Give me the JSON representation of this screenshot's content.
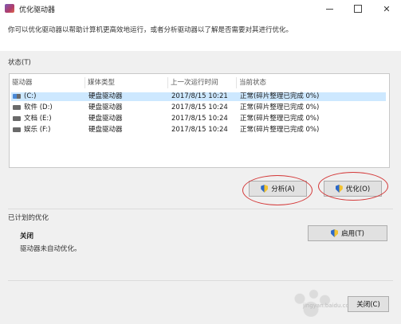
{
  "window": {
    "title": "优化驱动器",
    "controls": [
      "minimize-icon",
      "maximize-icon",
      "close-icon"
    ]
  },
  "intro": "你可以优化驱动器以帮助计算机更高效地运行，或者分析驱动器以了解是否需要对其进行优化。",
  "status": {
    "label": "状态(T)",
    "columns": [
      "驱动器",
      "媒体类型",
      "上一次运行时间",
      "当前状态"
    ],
    "drives": [
      {
        "name": "(C:)",
        "media": "硬盘驱动器",
        "last_run": "2017/8/15 10:21",
        "state": "正常(碎片整理已完成 0%)",
        "selected": true
      },
      {
        "name": "软件 (D:)",
        "media": "硬盘驱动器",
        "last_run": "2017/8/15 10:24",
        "state": "正常(碎片整理已完成 0%)",
        "selected": false
      },
      {
        "name": "文档 (E:)",
        "media": "硬盘驱动器",
        "last_run": "2017/8/15 10:24",
        "state": "正常(碎片整理已完成 0%)",
        "selected": false
      },
      {
        "name": "娱乐 (F:)",
        "media": "硬盘驱动器",
        "last_run": "2017/8/15 10:24",
        "state": "正常(碎片整理已完成 0%)",
        "selected": false
      }
    ]
  },
  "buttons": {
    "analyze": "分析(A)",
    "optimize": "优化(O)",
    "enable": "启用(T)",
    "close": "关闭(C)"
  },
  "scheduled": {
    "label": "已计划的优化",
    "title": "关闭",
    "description": "驱动器未自动优化。"
  },
  "watermark": "jingyan.baidu.com",
  "colors": {
    "selection": "#cde8ff",
    "annotation": "#d43a3a"
  }
}
